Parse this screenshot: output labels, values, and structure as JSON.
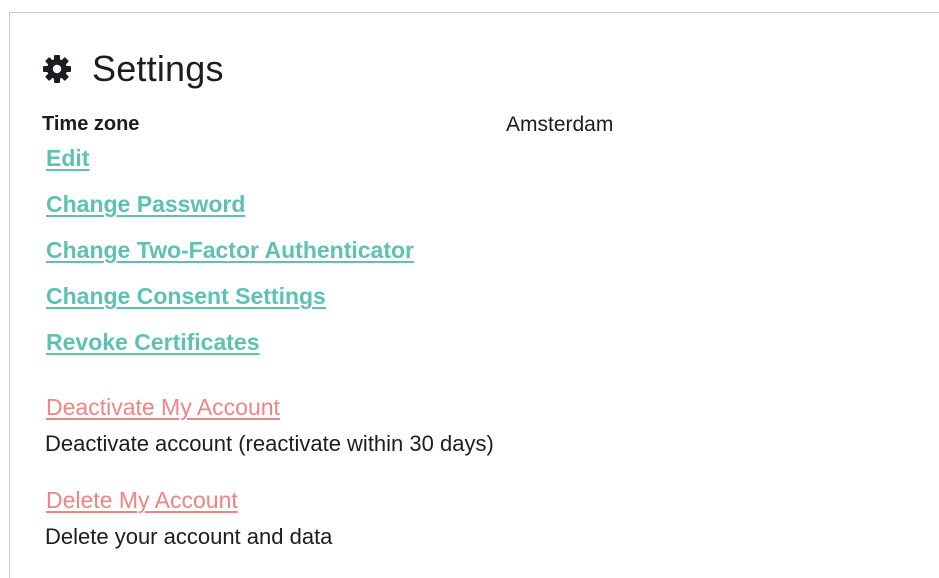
{
  "settings": {
    "title": "Settings",
    "icon": "gear-icon",
    "time_zone": {
      "label": "Time zone",
      "value": "Amsterdam"
    },
    "links": {
      "edit": "Edit",
      "change_password": "Change Password",
      "change_2fa": "Change Two-Factor Authenticator",
      "change_consent": "Change Consent Settings",
      "revoke_certificates": "Revoke Certificates"
    },
    "danger": {
      "deactivate_label": "Deactivate My Account",
      "deactivate_desc": "Deactivate account (reactivate within 30 days)",
      "delete_label": "Delete My Account",
      "delete_desc": "Delete your account and data"
    },
    "colors": {
      "link": "#5dc1b4",
      "danger": "#ef8484",
      "text": "#1a1d21",
      "border": "#c9c9c9"
    }
  }
}
